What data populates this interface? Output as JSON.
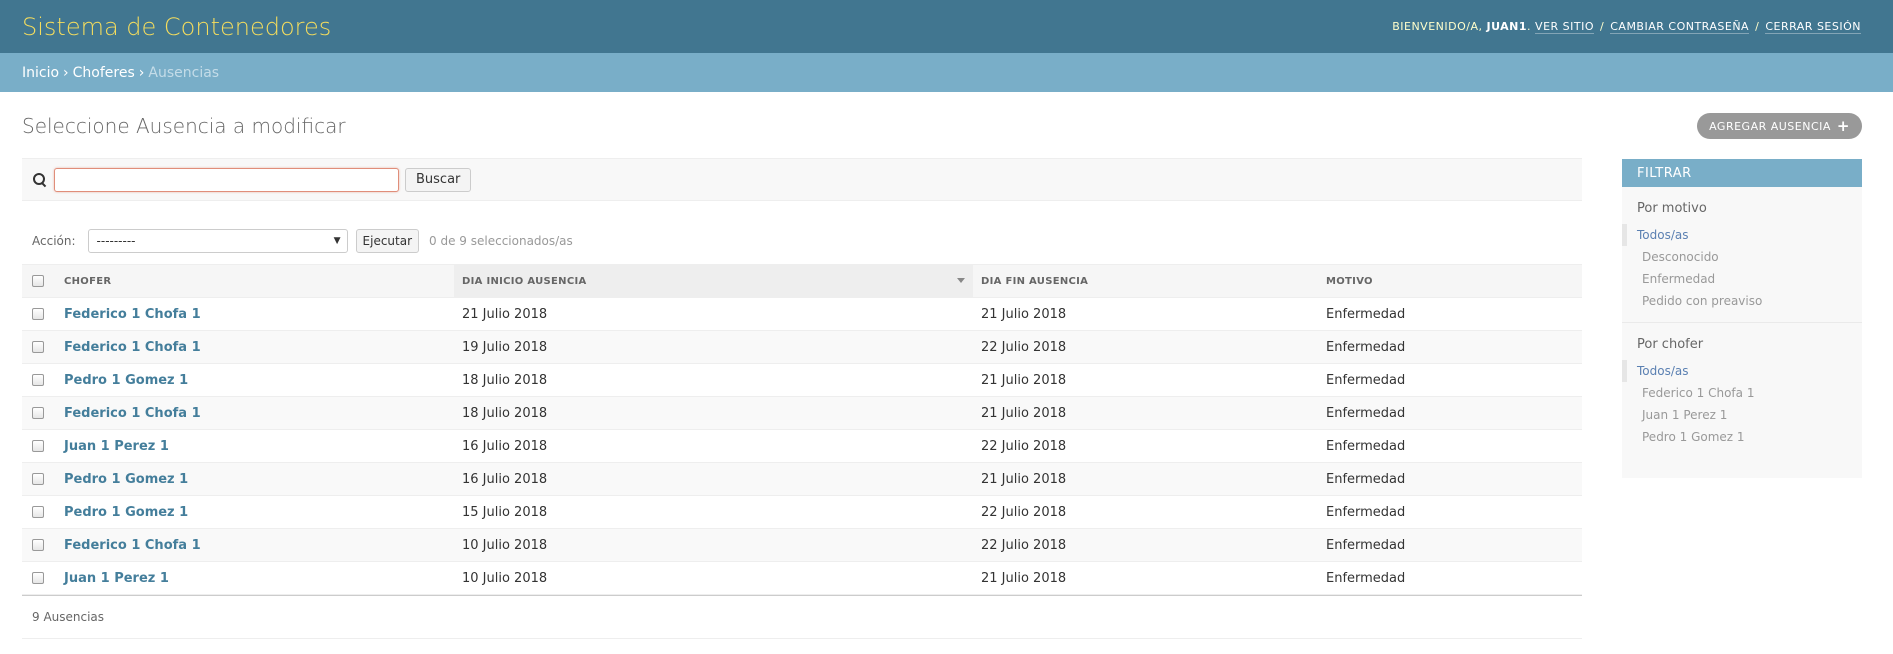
{
  "header": {
    "site_title": "Sistema de Contenedores",
    "welcome": "BIENVENIDO/A,",
    "username": "JUAN1",
    "view_site": "VER SITIO",
    "change_password": "CAMBIAR CONTRASEÑA",
    "logout": "CERRAR SESIÓN",
    "separator": "/"
  },
  "breadcrumbs": {
    "home": "Inicio",
    "app": "Choferes",
    "current": "Ausencias",
    "separator": "›"
  },
  "page": {
    "title": "Seleccione Ausencia a modificar",
    "add_button": "AGREGAR AUSENCIA",
    "add_icon": "plus-icon"
  },
  "search": {
    "value": "",
    "placeholder": "",
    "button_label": "Buscar",
    "icon": "search-icon"
  },
  "actions": {
    "label": "Acción:",
    "selected_option": "---------",
    "run_button": "Ejecutar",
    "counter": "0 de 9 seleccionados/as"
  },
  "table": {
    "columns": [
      "CHOFER",
      "DIA INICIO AUSENCIA",
      "DIA FIN AUSENCIA",
      "MOTIVO"
    ],
    "sorted_column": "DIA INICIO AUSENCIA",
    "rows": [
      {
        "chofer": "Federico 1 Chofa 1",
        "inicio": "21 Julio 2018",
        "fin": "21 Julio 2018",
        "motivo": "Enfermedad"
      },
      {
        "chofer": "Federico 1 Chofa 1",
        "inicio": "19 Julio 2018",
        "fin": "22 Julio 2018",
        "motivo": "Enfermedad"
      },
      {
        "chofer": "Pedro 1 Gomez 1",
        "inicio": "18 Julio 2018",
        "fin": "21 Julio 2018",
        "motivo": "Enfermedad"
      },
      {
        "chofer": "Federico 1 Chofa 1",
        "inicio": "18 Julio 2018",
        "fin": "21 Julio 2018",
        "motivo": "Enfermedad"
      },
      {
        "chofer": "Juan 1 Perez 1",
        "inicio": "16 Julio 2018",
        "fin": "22 Julio 2018",
        "motivo": "Enfermedad"
      },
      {
        "chofer": "Pedro 1 Gomez 1",
        "inicio": "16 Julio 2018",
        "fin": "21 Julio 2018",
        "motivo": "Enfermedad"
      },
      {
        "chofer": "Pedro 1 Gomez 1",
        "inicio": "15 Julio 2018",
        "fin": "22 Julio 2018",
        "motivo": "Enfermedad"
      },
      {
        "chofer": "Federico 1 Chofa 1",
        "inicio": "10 Julio 2018",
        "fin": "22 Julio 2018",
        "motivo": "Enfermedad"
      },
      {
        "chofer": "Juan 1 Perez 1",
        "inicio": "10 Julio 2018",
        "fin": "21 Julio 2018",
        "motivo": "Enfermedad"
      }
    ],
    "footer_count": "9 Ausencias"
  },
  "filter": {
    "title": "FILTRAR",
    "groups": [
      {
        "title": "Por motivo",
        "options": [
          "Todos/as",
          "Desconocido",
          "Enfermedad",
          "Pedido con preaviso"
        ],
        "selected": 0
      },
      {
        "title": "Por chofer",
        "options": [
          "Todos/as",
          "Federico 1 Chofa 1",
          "Juan 1 Perez 1",
          "Pedro 1 Gomez 1"
        ],
        "selected": 0
      }
    ]
  },
  "colors": {
    "header_bg": "#417690",
    "breadcrumb_bg": "#79aec8",
    "branding": "#f5dd5d",
    "link": "#447e9b"
  }
}
